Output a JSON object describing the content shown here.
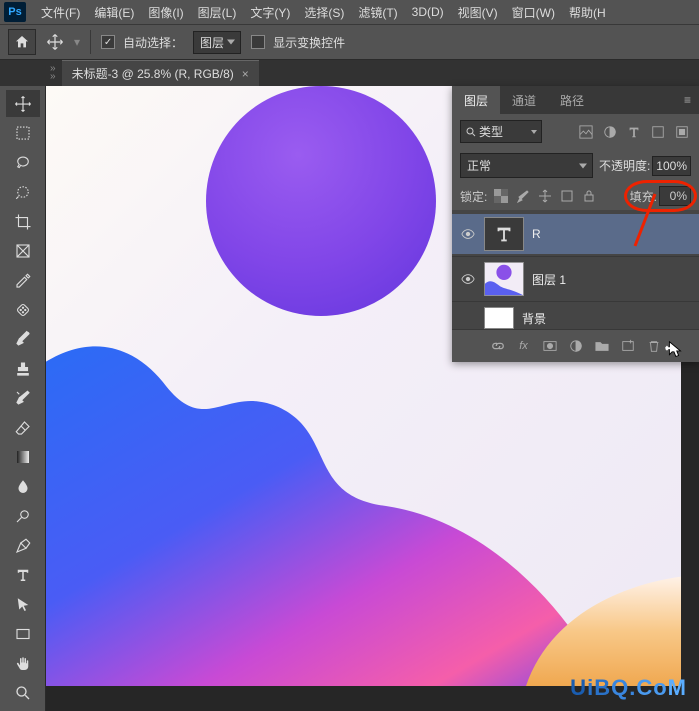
{
  "app": {
    "logo": "Ps"
  },
  "menu": {
    "file": "文件(F)",
    "edit": "编辑(E)",
    "image": "图像(I)",
    "layer": "图层(L)",
    "type": "文字(Y)",
    "select": "选择(S)",
    "filter": "滤镜(T)",
    "3d": "3D(D)",
    "view": "视图(V)",
    "window": "窗口(W)",
    "help": "帮助(H"
  },
  "optbar": {
    "auto_select": "自动选择：",
    "target": "图层",
    "show_transform": "显示变换控件"
  },
  "document": {
    "title": "未标题-3 @ 25.8% (R, RGB/8)"
  },
  "panels": {
    "tabs": {
      "layers": "图层",
      "channels": "通道",
      "paths": "路径"
    },
    "filter_label": "类型",
    "blend_mode": "正常",
    "opacity_label": "不透明度:",
    "opacity_value": "100%",
    "lock_label": "锁定:",
    "fill_label": "填充:",
    "fill_value": "0%",
    "layers": [
      {
        "name": "R",
        "type": "text"
      },
      {
        "name": "图层 1",
        "type": "image"
      },
      {
        "name": "背景",
        "type": "bg"
      }
    ]
  },
  "watermark": {
    "text": "UiBQ.CoM"
  }
}
